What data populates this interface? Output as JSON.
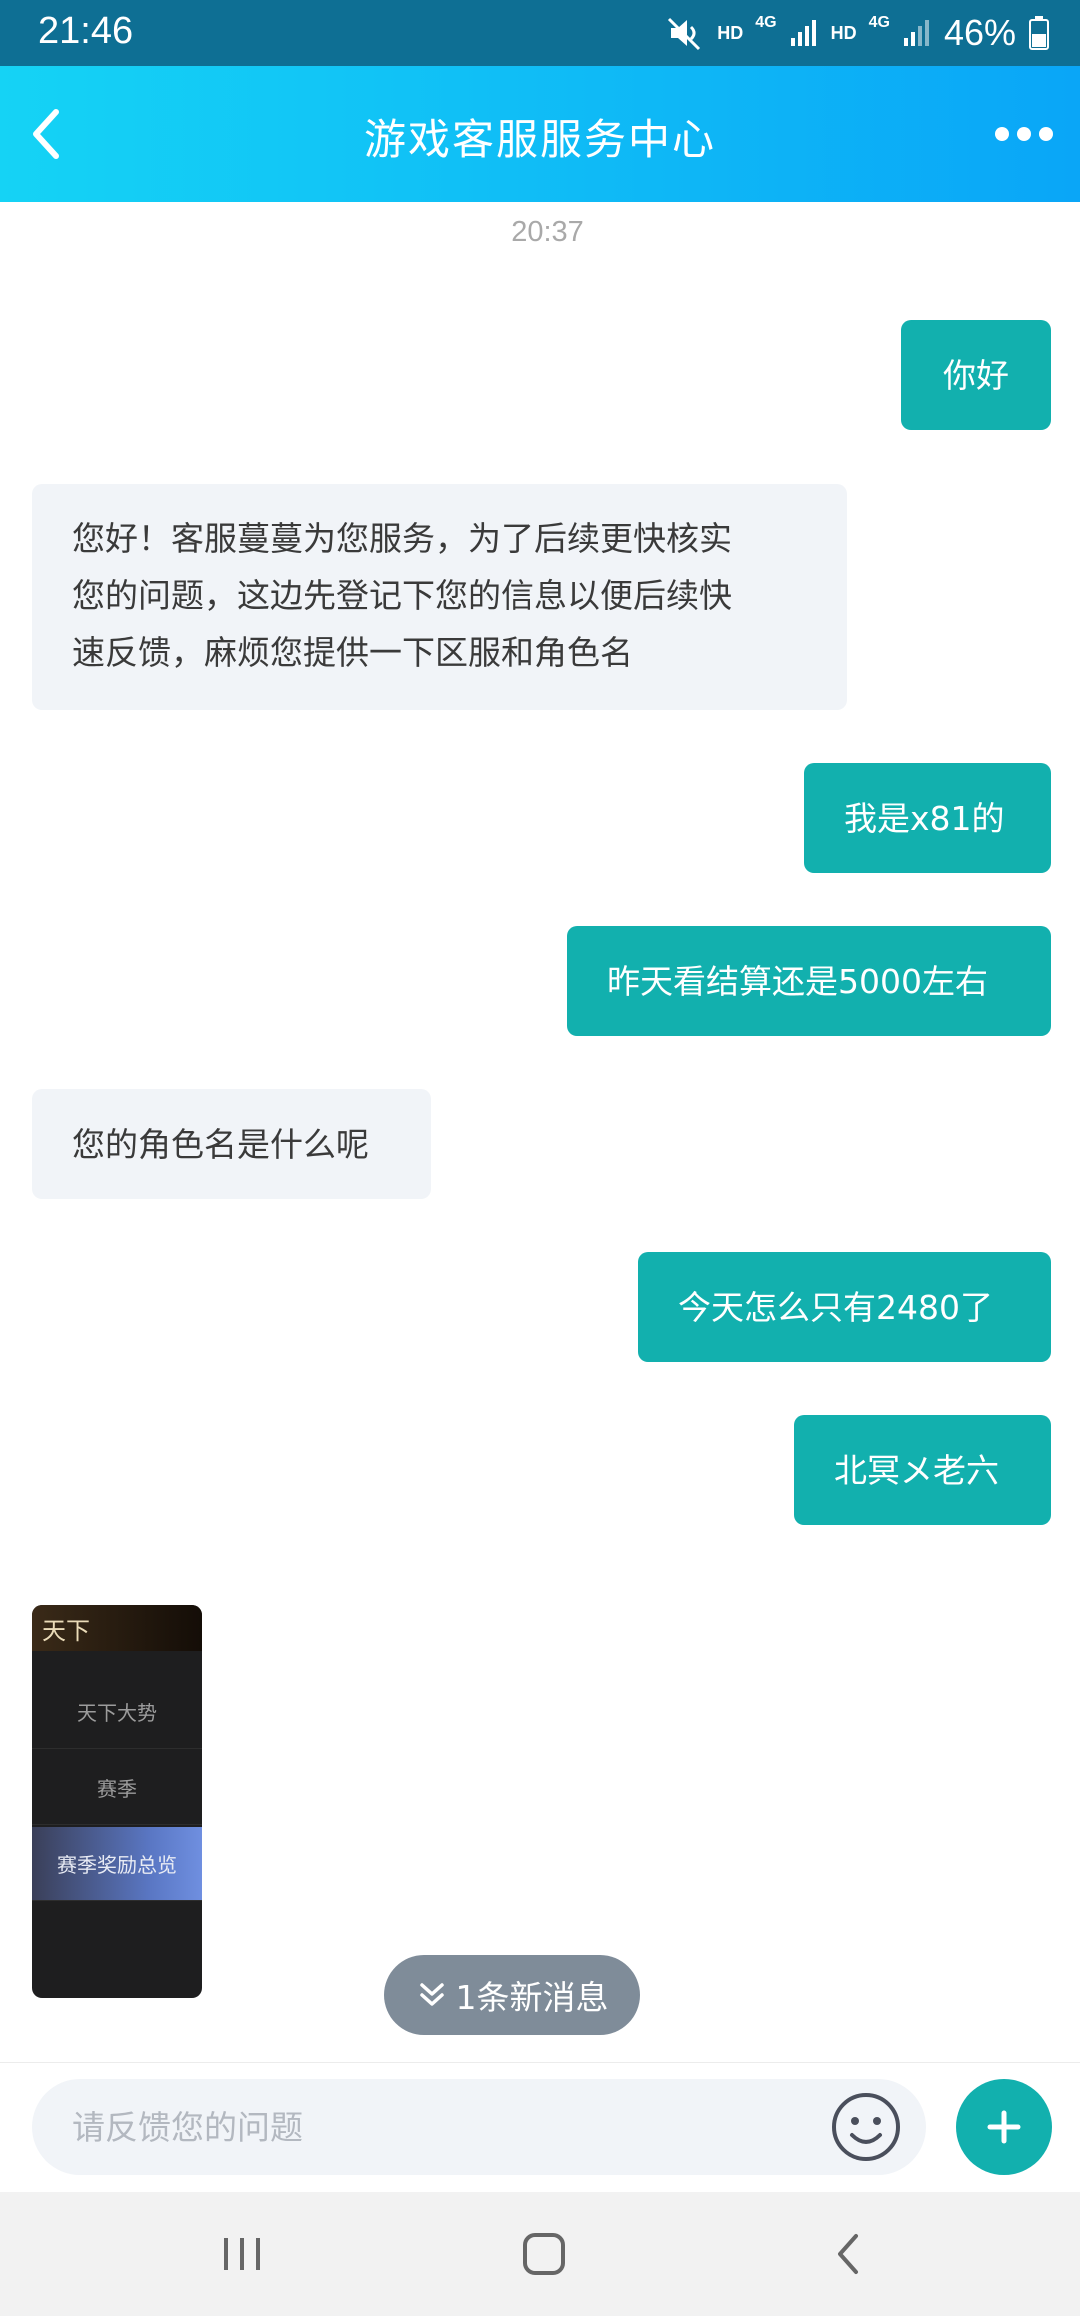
{
  "status_bar": {
    "time": "21:46",
    "hd1": "HD",
    "net1": "4G",
    "hd2": "HD",
    "net2": "4G",
    "battery": "46%"
  },
  "header": {
    "title": "游戏客服服务中心"
  },
  "chat": {
    "timestamp": "20:37",
    "messages": [
      {
        "from": "user",
        "text": "你好"
      },
      {
        "from": "agent",
        "text": "您好！客服蔓蔓为您服务，为了后续更快核实您的问题，这边先登记下您的信息以便后续快速反馈，麻烦您提供一下区服和角色名",
        "lines": [
          "您好！客服蔓蔓为您服务，为了后续更快核实",
          "您的问题，这边先登记下您的信息以便后续快",
          "速反馈，麻烦您提供一下区服和角色名"
        ]
      },
      {
        "from": "user",
        "text": "我是x81的"
      },
      {
        "from": "user",
        "text": "昨天看结算还是5000左右"
      },
      {
        "from": "agent",
        "text": "您的角色名是什么呢"
      },
      {
        "from": "user",
        "text": "今天怎么只有2480了"
      },
      {
        "from": "user",
        "text": "北冥メ老六"
      }
    ],
    "image_message": {
      "header_text": "天下",
      "rows": [
        "天下大势",
        "赛季",
        "赛季奖励总览"
      ]
    },
    "new_message_pill": "1条新消息"
  },
  "input": {
    "placeholder": "请反馈您的问题"
  },
  "colors": {
    "header_gradient_start": "#15d3f5",
    "header_gradient_end": "#0aa6f7",
    "outgoing_bubble": "#12b0ae",
    "incoming_bubble": "#f1f4f8"
  }
}
